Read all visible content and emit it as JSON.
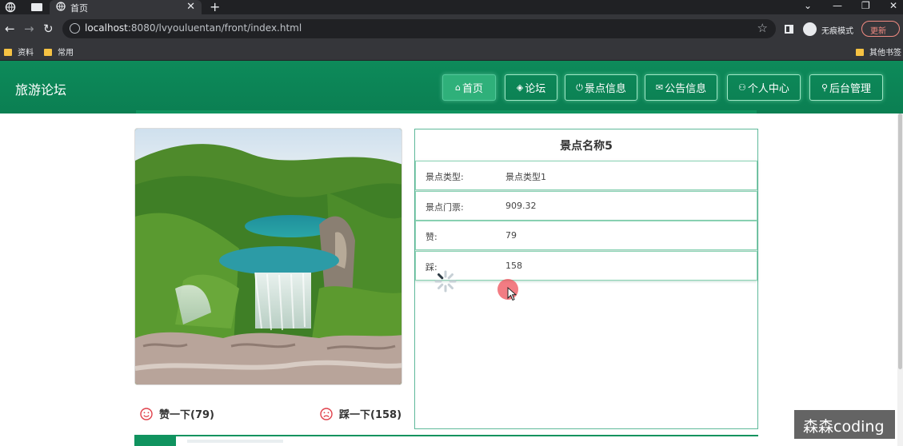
{
  "browser": {
    "tab_title": "首页",
    "tab_close": "✕",
    "new_tab": "+",
    "url_host": "localhost",
    "url_rest": ":8080/lvyouluentan/front/index.html",
    "incognito_label": "无痕模式",
    "update_label": "更新",
    "bookmarks": [
      "资料",
      "常用"
    ],
    "other_bookmarks": "其他书签",
    "controls": {
      "minimize": "—",
      "restore": "❐",
      "close": "✕",
      "dropdown": "⌄"
    }
  },
  "site": {
    "brand": "旅游论坛",
    "nav": [
      {
        "icon": "⌂",
        "label": "首页"
      },
      {
        "icon": "◈",
        "label": "论坛"
      },
      {
        "icon": "⏻",
        "label": "景点信息"
      },
      {
        "icon": "✉",
        "label": "公告信息"
      },
      {
        "icon": "⚇",
        "label": "个人中心"
      },
      {
        "icon": "⚲",
        "label": "后台管理"
      }
    ]
  },
  "detail": {
    "title": "景点名称5",
    "rows": [
      {
        "key": "景点类型:",
        "value": "景点类型1"
      },
      {
        "key": "景点门票:",
        "value": "909.32"
      },
      {
        "key": "赞:",
        "value": "79"
      },
      {
        "key": "踩:",
        "value": "158"
      }
    ]
  },
  "votes": {
    "like": "赞一下(79)",
    "dislike": "踩一下(158)"
  },
  "watermark": "森森coding",
  "colors": {
    "header": "#0b7f52",
    "accent": "#10935f",
    "active_nav": "#2fb07a",
    "face": "#e0404a"
  },
  "icons": {
    "photo": "landscape-waterfall-image",
    "like": "smile-face-icon",
    "dislike": "sad-face-icon"
  }
}
